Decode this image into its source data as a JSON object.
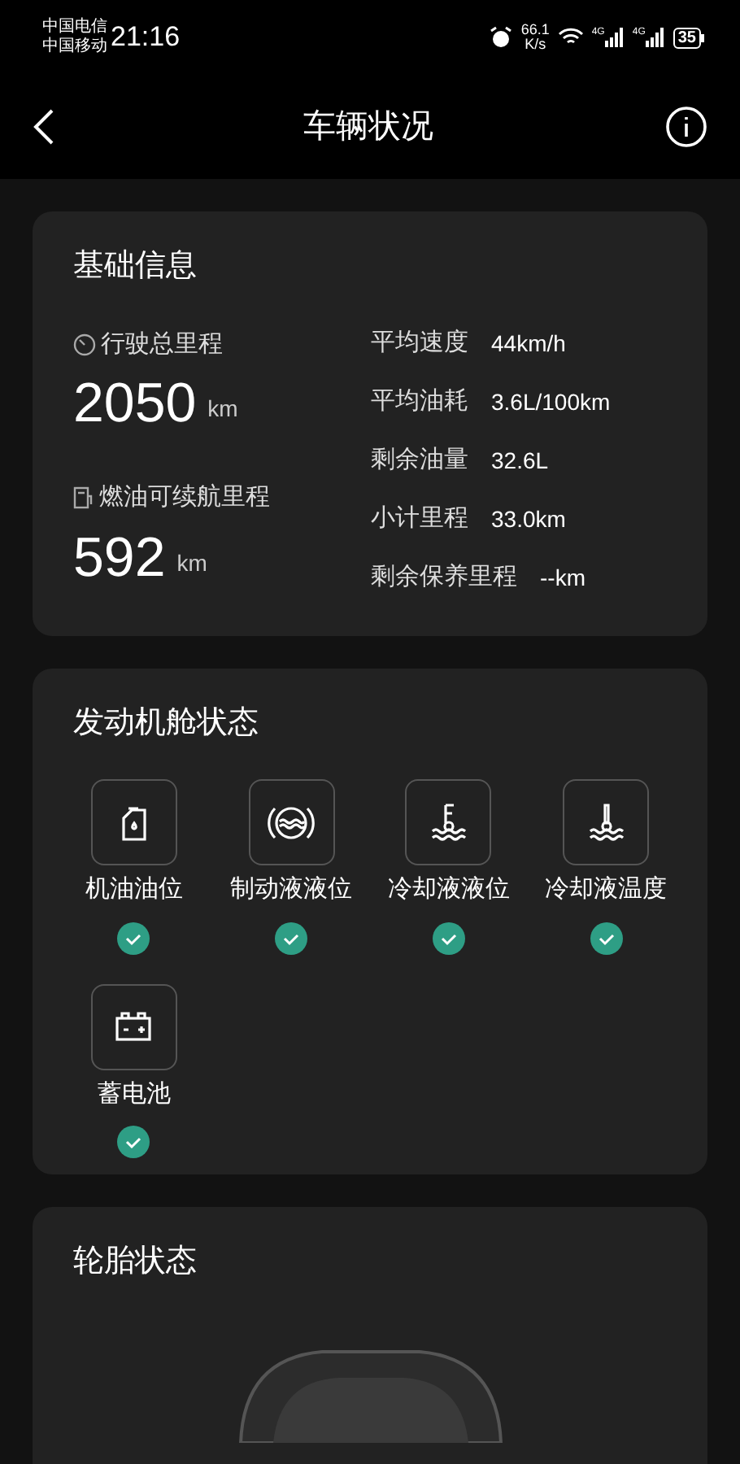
{
  "status_bar": {
    "carriers": [
      "中国电信",
      "中国移动"
    ],
    "time": "21:16",
    "net_speed": [
      "66.1",
      "K/s"
    ],
    "network_labels": [
      "4G",
      "4G"
    ],
    "battery": "35"
  },
  "header": {
    "title": "车辆状况"
  },
  "basic_info": {
    "title": "基础信息",
    "totals": [
      {
        "kind": "odometer",
        "label": "行驶总里程",
        "value": "2050",
        "unit": "km"
      },
      {
        "kind": "range",
        "label": "燃油可续航里程",
        "value": "592",
        "unit": "km"
      }
    ],
    "stats": [
      {
        "label": "平均速度",
        "value": "44km/h"
      },
      {
        "label": "平均油耗",
        "value": "3.6L/100km"
      },
      {
        "label": "剩余油量",
        "value": "32.6L"
      },
      {
        "label": "小计里程",
        "value": "33.0km"
      },
      {
        "label": "剩余保养里程",
        "value": "--km"
      }
    ]
  },
  "engine_bay": {
    "title": "发动机舱状态",
    "items": [
      {
        "kind": "oil",
        "label": "机油油位",
        "ok": true
      },
      {
        "kind": "brake",
        "label": "制动液液位",
        "ok": true
      },
      {
        "kind": "coolant_level",
        "label": "冷却液液位",
        "ok": true
      },
      {
        "kind": "coolant_temp",
        "label": "冷却液温度",
        "ok": true
      },
      {
        "kind": "battery",
        "label": "蓄电池",
        "ok": true
      }
    ]
  },
  "tires": {
    "title": "轮胎状态"
  }
}
